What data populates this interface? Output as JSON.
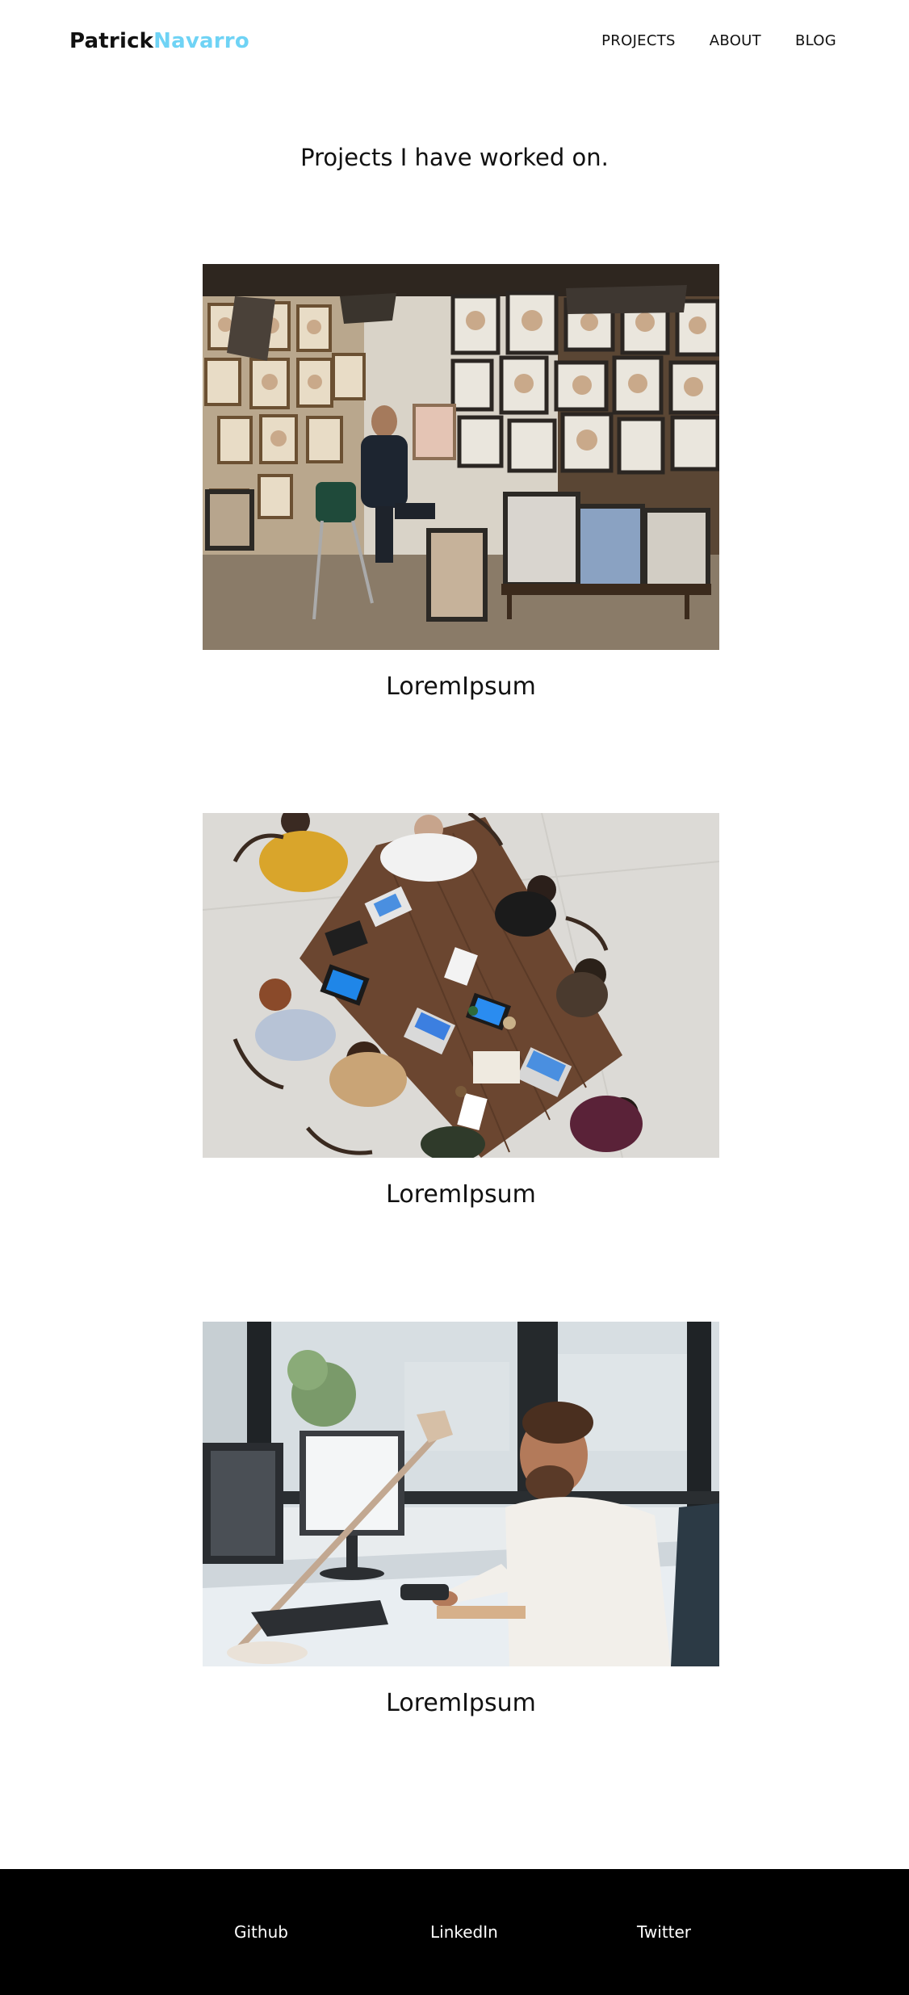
{
  "header": {
    "logo_first": "Patrick",
    "logo_second": "Navarro",
    "nav": [
      {
        "label": "PROJECTS"
      },
      {
        "label": "ABOUT"
      },
      {
        "label": "BLOG"
      }
    ]
  },
  "main": {
    "heading": "Projects I have worked on.",
    "projects": [
      {
        "caption": "LoremIpsum",
        "image": "portrait-artist-studio-photo"
      },
      {
        "caption": "LoremIpsum",
        "image": "team-meeting-table-overhead-photo"
      },
      {
        "caption": "LoremIpsum",
        "image": "man-at-computer-office-photo"
      }
    ]
  },
  "footer": {
    "links": [
      {
        "label": "Github"
      },
      {
        "label": "LinkedIn"
      },
      {
        "label": "Twitter"
      }
    ]
  },
  "colors": {
    "accent": "#6fd3f5",
    "text": "#111111",
    "footer_bg": "#000000"
  }
}
